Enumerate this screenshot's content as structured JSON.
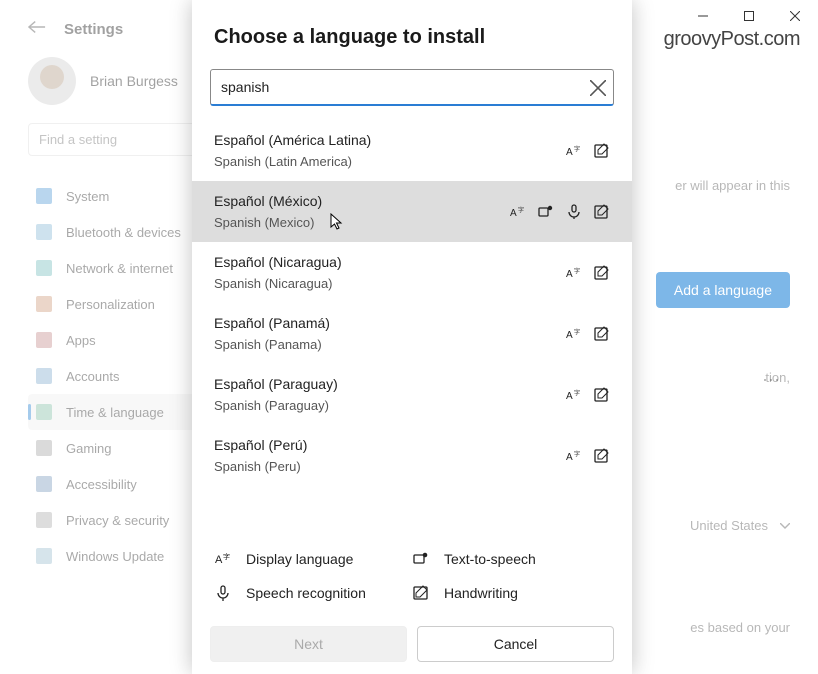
{
  "window": {
    "settings_title": "Settings",
    "user_name": "Brian Burgess",
    "find_placeholder": "Find a setting",
    "watermark": "groovyPost.com"
  },
  "nav": {
    "items": [
      {
        "label": "System"
      },
      {
        "label": "Bluetooth & devices"
      },
      {
        "label": "Network & internet"
      },
      {
        "label": "Personalization"
      },
      {
        "label": "Apps"
      },
      {
        "label": "Accounts"
      },
      {
        "label": "Time & language"
      },
      {
        "label": "Gaming"
      },
      {
        "label": "Accessibility"
      },
      {
        "label": "Privacy & security"
      },
      {
        "label": "Windows Update"
      }
    ],
    "selected_index": 6
  },
  "right": {
    "hint1": "er will appear in this",
    "add_language": "Add a language",
    "hint2": "tion,",
    "region_value": "United States",
    "hint3": "es based on your"
  },
  "dialog": {
    "title": "Choose a language to install",
    "search_value": "spanish",
    "next_label": "Next",
    "cancel_label": "Cancel",
    "legend": {
      "display": "Display language",
      "tts": "Text-to-speech",
      "speech": "Speech recognition",
      "handwriting": "Handwriting"
    },
    "languages": [
      {
        "native": "Español (América Latina)",
        "english": "Spanish (Latin America)",
        "icons": [
          "display",
          "handwriting"
        ],
        "selected": false
      },
      {
        "native": "Español (México)",
        "english": "Spanish (Mexico)",
        "icons": [
          "display",
          "tts",
          "speech",
          "handwriting"
        ],
        "selected": true
      },
      {
        "native": "Español (Nicaragua)",
        "english": "Spanish (Nicaragua)",
        "icons": [
          "display",
          "handwriting"
        ],
        "selected": false
      },
      {
        "native": "Español (Panamá)",
        "english": "Spanish (Panama)",
        "icons": [
          "display",
          "handwriting"
        ],
        "selected": false
      },
      {
        "native": "Español (Paraguay)",
        "english": "Spanish (Paraguay)",
        "icons": [
          "display",
          "handwriting"
        ],
        "selected": false
      },
      {
        "native": "Español (Perú)",
        "english": "Spanish (Peru)",
        "icons": [
          "display",
          "handwriting"
        ],
        "selected": false
      }
    ]
  }
}
